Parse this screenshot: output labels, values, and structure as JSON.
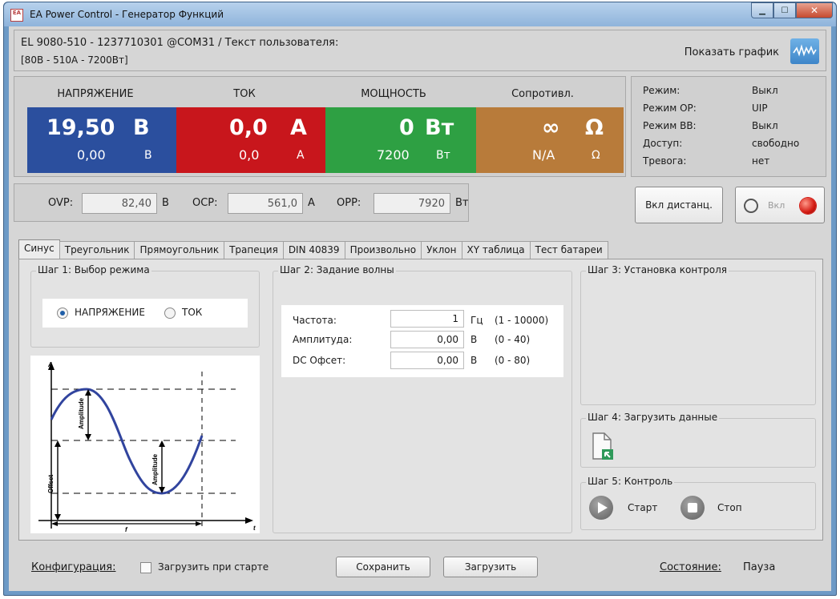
{
  "window": {
    "title": "EA Power Control - Генератор Функций",
    "app_icon_text": "EA",
    "controls": [
      "minimize",
      "maximize",
      "close"
    ]
  },
  "device": {
    "line1": "EL 9080-510 - 1237710301 @COM31 / Текст пользователя:",
    "line2": "[80В - 510А - 7200Вт]",
    "show_graph_label": "Показать график"
  },
  "measurements": {
    "headers": [
      "НАПРЯЖЕНИЕ",
      "ТОК",
      "МОЩНОСТЬ",
      "Сопротивл."
    ],
    "voltage": {
      "actual": "19,50",
      "unit": "В",
      "set": "0,00",
      "set_unit": "В",
      "color": "#2b4f9e"
    },
    "current": {
      "actual": "0,0",
      "unit": "А",
      "set": "0,0",
      "set_unit": "А",
      "color": "#c8161c"
    },
    "power": {
      "actual": "0",
      "unit": "Вт",
      "set": "7200",
      "set_unit": "Вт",
      "color": "#2ea043"
    },
    "resistance": {
      "actual": "∞",
      "unit": "Ω",
      "set": "N/A",
      "set_unit": "Ω",
      "color": "#b87b3a"
    }
  },
  "status": [
    {
      "key": "Режим:",
      "value": "Выкл"
    },
    {
      "key": "Режим ОР:",
      "value": "UIP"
    },
    {
      "key": "Режим ВВ:",
      "value": "Выкл"
    },
    {
      "key": "Доступ:",
      "value": "свободно"
    },
    {
      "key": "Тревога:",
      "value": "нет"
    }
  ],
  "protection": {
    "ovp_label": "OVP:",
    "ovp_value": "82,40",
    "ovp_unit": "В",
    "ocp_label": "OCP:",
    "ocp_value": "561,0",
    "ocp_unit": "А",
    "opp_label": "OPP:",
    "opp_value": "7920",
    "opp_unit": "Вт"
  },
  "remote_button": "Вкл дистанц.",
  "output": {
    "label": "Вкл",
    "led_color": "#d31a12"
  },
  "tabs": [
    "Синус",
    "Треугольник",
    "Прямоугольник",
    "Трапеция",
    "DIN 40839",
    "Произвольно",
    "Уклон",
    "XY таблица",
    "Тест батареи"
  ],
  "active_tab": "Синус",
  "step1": {
    "title": "Шаг 1: Выбор режима",
    "options": [
      "НАПРЯЖЕНИЕ",
      "ТОК"
    ],
    "selected": "НАПРЯЖЕНИЕ"
  },
  "diagram": {
    "axis_a": "A",
    "axis_t": "t",
    "amplitude": "Amplitude",
    "offset": "Offset",
    "period": "f"
  },
  "step2": {
    "title": "Шаг 2: Задание волны",
    "params": [
      {
        "label": "Частота:",
        "value": "1",
        "unit": "Гц",
        "range": "(1 - 10000)"
      },
      {
        "label": "Амплитуда:",
        "value": "0,00",
        "unit": "В",
        "range": "(0 - 40)"
      },
      {
        "label": "DC Офсет:",
        "value": "0,00",
        "unit": "В",
        "range": "(0 - 80)"
      }
    ]
  },
  "step3": {
    "title": "Шаг 3: Установка контроля"
  },
  "step4": {
    "title": "Шаг 4: Загрузить данные"
  },
  "step5": {
    "title": "Шаг 5: Контроль",
    "start": "Старт",
    "stop": "Стоп"
  },
  "footer": {
    "config_label": "Конфигурация:",
    "load_on_start": "Загрузить при старте",
    "save_button": "Сохранить",
    "load_button": "Загрузить",
    "state_label": "Состояние:",
    "state_value": "Пауза"
  }
}
